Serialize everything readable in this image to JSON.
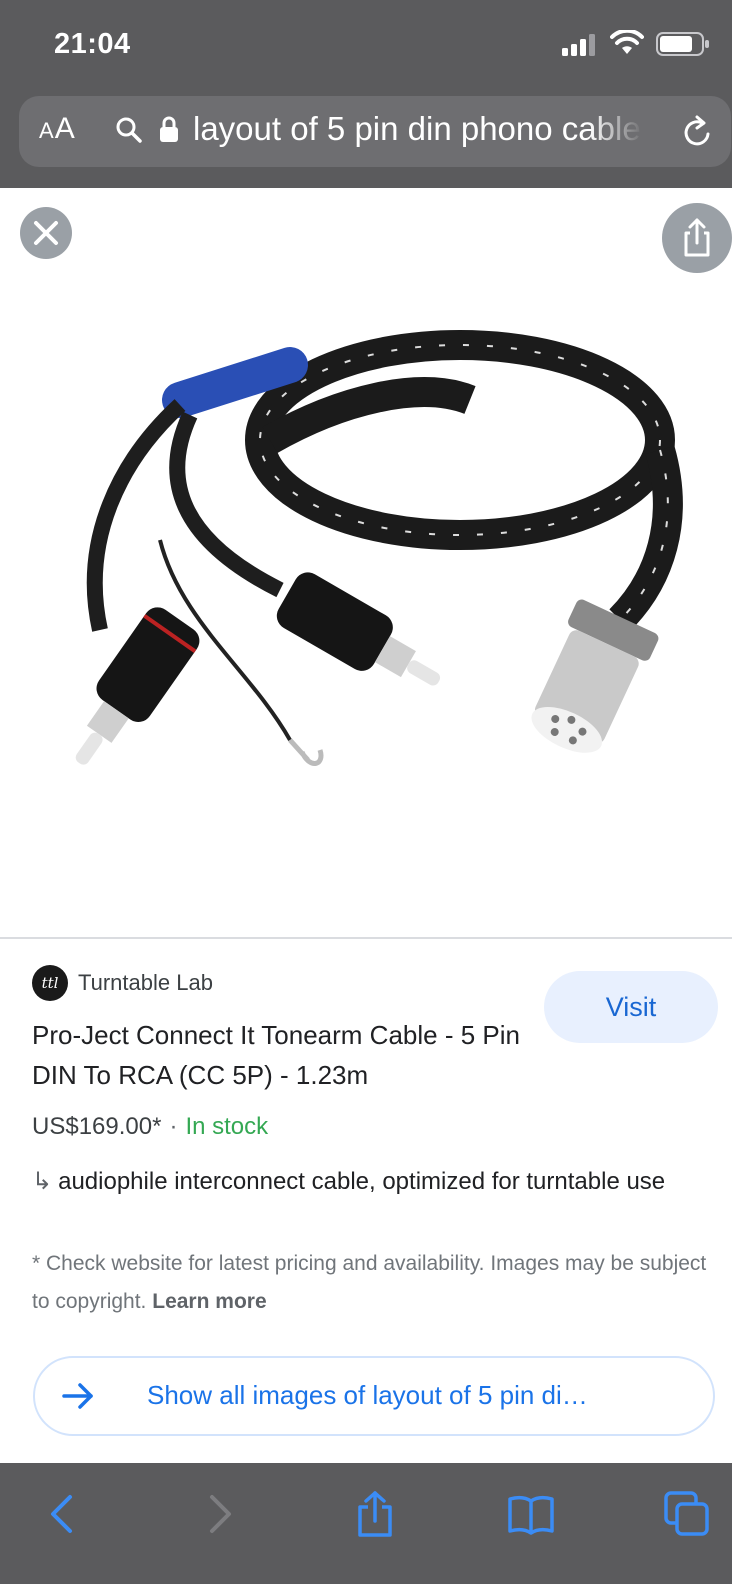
{
  "status_bar": {
    "time": "21:04",
    "icons": [
      "cellular-signal-icon",
      "wifi-icon",
      "battery-icon"
    ]
  },
  "url_bar": {
    "text_size_label": "AA",
    "url_text": "layout of 5 pin din phono cable",
    "icons": [
      "search-icon",
      "lock-icon",
      "reload-icon"
    ]
  },
  "viewer": {
    "close_icon": "close-icon",
    "share_icon": "share-icon",
    "image_alt_icon": "cable-product-image"
  },
  "result": {
    "source_logo_text": "ttl",
    "source_name": "Turntable Lab",
    "visit_label": "Visit",
    "title": "Pro-Ject Connect It Tonearm Cable - 5 Pin DIN To RCA (CC 5P) - 1.23m",
    "price": "US$169.00*",
    "separator": "·",
    "stock": "In stock",
    "description_arrow": "↳",
    "description": "audiophile interconnect cable, optimized for turntable use",
    "disclaimer": "* Check website for latest pricing and availability. Images may be subject to copyright.",
    "learn_more": "Learn more",
    "show_all_label": "Show all images of layout of 5 pin di…"
  },
  "toolbar": {
    "icons": [
      "back-icon",
      "forward-icon",
      "share-icon",
      "bookmarks-icon",
      "tabs-icon"
    ]
  },
  "colors": {
    "chrome": "#5b5b5d",
    "accent_blue": "#1a73e8",
    "stock_green": "#34a853",
    "toolbar_icon_blue": "#3b8cf5"
  }
}
